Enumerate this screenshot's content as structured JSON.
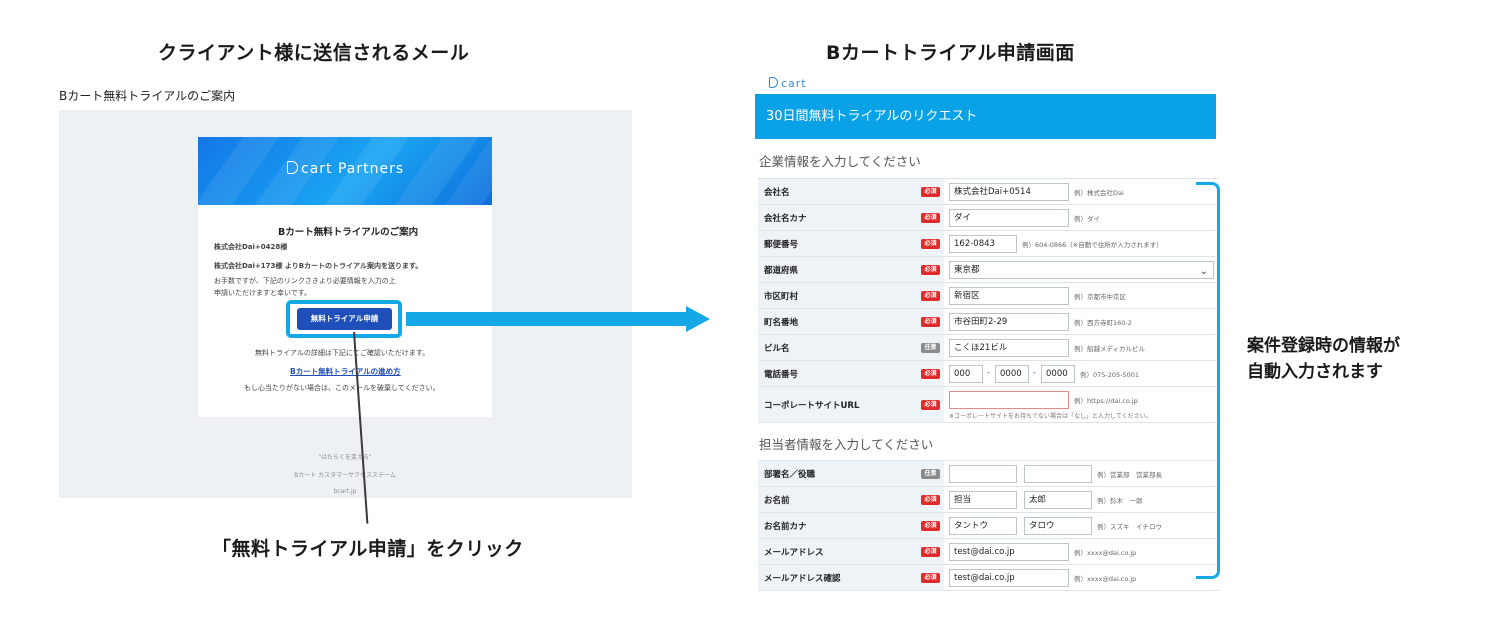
{
  "left_heading": "クライアント様に送信されるメール",
  "right_heading": "Bカートトライアル申請画面",
  "email": {
    "subject": "Bカート無料トライアルのご案内",
    "brand": "cart Partners",
    "title": "Bカート無料トライアルのご案内",
    "recipient": "株式会社Dai+0428様",
    "body_line1": "株式会社Dai+173様 よりBカートのトライアル案内を送ります。",
    "body_line2": "お手数ですが、下記のリンクさきより必要情報を入力の上",
    "body_line3": "申請いただけますと幸いです。",
    "cta_label": "無料トライアル申請",
    "detail_line": "無料トライアルの詳細は下記にてご確認いただけます。",
    "link_label": "Bカート無料トライアルの進め方",
    "discard_line": "もし心当たりがない場合は、このメールを破棄してください。",
    "footer_slogan": "\"はたらくを変える\"",
    "footer_system": "Bカート カスタマーサクセスステーム",
    "footer_domain": "bcart.jp"
  },
  "instruction": "「無料トライアル申請」をクリック",
  "form": {
    "logo": "cart",
    "banner": "30日間無料トライアルのリクエスト",
    "company_section": "企業情報を入力してください",
    "contact_section": "担当者情報を入力してください",
    "required_label": "必須",
    "optional_label": "任意",
    "company_rows": [
      {
        "label": "会社名",
        "value": "株式会社Dai+0514",
        "example": "例）株式会社Dai"
      },
      {
        "label": "会社名カナ",
        "value": "ダイ",
        "example": "例）ダイ"
      },
      {
        "label": "郵便番号",
        "value": "162-0843",
        "example": "例）604-0866（※自動で住所が入力されます）"
      },
      {
        "label": "都道府県",
        "value": "東京都"
      },
      {
        "label": "市区町村",
        "value": "新宿区",
        "example": "例）京都市中京区"
      },
      {
        "label": "町名番地",
        "value": "市谷田町2-29",
        "example": "例）西方寺町160-2"
      },
      {
        "label": "ビル名",
        "value": "こくほ21ビル",
        "example": "例）船越メディカルビル"
      },
      {
        "label": "電話番号",
        "value1": "000",
        "value2": "0000",
        "value3": "0000",
        "example": "例）075-205-5001"
      },
      {
        "label": "コーポレートサイトURL",
        "value": "",
        "example": "例）https://dai.co.jp",
        "note": "※コーポレートサイトをお持ちでない場合は「なし」と入力してください。"
      }
    ],
    "contact_rows": [
      {
        "label": "部署名／役職",
        "value1": "",
        "value2": "",
        "example": "例）営業部　営業部長"
      },
      {
        "label": "お名前",
        "value1": "担当",
        "value2": "太郎",
        "example": "例）鈴木　一郎"
      },
      {
        "label": "お名前カナ",
        "value1": "タントウ",
        "value2": "タロウ",
        "example": "例）スズキ　イチロウ"
      },
      {
        "label": "メールアドレス",
        "value": "test@dai.co.jp",
        "example": "例）xxxx@dai.co.jp"
      },
      {
        "label": "メールアドレス確認",
        "value": "test@dai.co.jp",
        "example": "例）xxxx@dai.co.jp"
      }
    ]
  },
  "callout_line1": "案件登録時の情報が",
  "callout_line2": "自動入力されます"
}
